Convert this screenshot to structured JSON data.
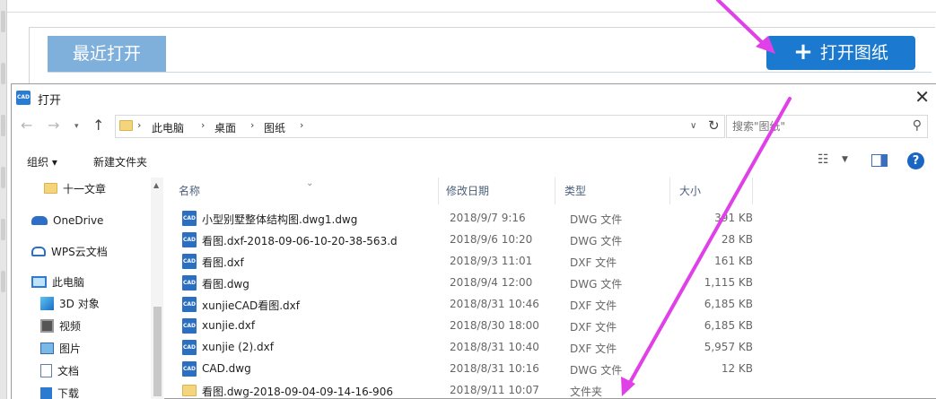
{
  "app": {
    "recent_tab": "最近打开",
    "open_button": "打开图纸"
  },
  "dialog": {
    "logo": "CAD",
    "title": "打开",
    "breadcrumbs": [
      "此电脑",
      "桌面",
      "图纸"
    ],
    "search_placeholder": "搜索\"图纸\"",
    "toolbar": {
      "organize": "组织 ▾",
      "new_folder": "新建文件夹"
    },
    "nav": [
      "十一文章",
      "OneDrive",
      "WPS云文档",
      "此电脑",
      "3D 对象",
      "视频",
      "图片",
      "文档",
      "下载"
    ],
    "columns": [
      "名称",
      "修改日期",
      "类型",
      "大小"
    ],
    "files": [
      {
        "name": "小型别墅整体结构图.dwg1.dwg",
        "date": "2018/9/7 9:16",
        "type": "DWG 文件",
        "size": "391 KB"
      },
      {
        "name": "看图.dxf-2018-09-06-10-20-38-563.d",
        "date": "2018/9/6 10:20",
        "type": "DWG 文件",
        "size": "28 KB"
      },
      {
        "name": "看图.dxf",
        "date": "2018/9/3 11:01",
        "type": "DXF 文件",
        "size": "161 KB"
      },
      {
        "name": "看图.dwg",
        "date": "2018/9/4 12:00",
        "type": "DWG 文件",
        "size": "1,115 KB"
      },
      {
        "name": "xunjieCAD看图.dxf",
        "date": "2018/8/31 10:46",
        "type": "DXF 文件",
        "size": "6,185 KB"
      },
      {
        "name": "xunjie.dxf",
        "date": "2018/8/30 18:00",
        "type": "DXF 文件",
        "size": "6,185 KB"
      },
      {
        "name": "xunjie (2).dxf",
        "date": "2018/8/31 10:40",
        "type": "DXF 文件",
        "size": "5,957 KB"
      },
      {
        "name": "CAD.dwg",
        "date": "2018/8/31 10:16",
        "type": "DWG 文件",
        "size": "12 KB"
      },
      {
        "name": "看图.dwg-2018-09-04-09-14-16-906",
        "date": "2018/9/11 10:07",
        "type": "文件夹",
        "size": ""
      }
    ]
  },
  "colors": {
    "accent": "#1b7ad0",
    "tab": "#7fb0dc",
    "arrow": "#e040e8"
  }
}
